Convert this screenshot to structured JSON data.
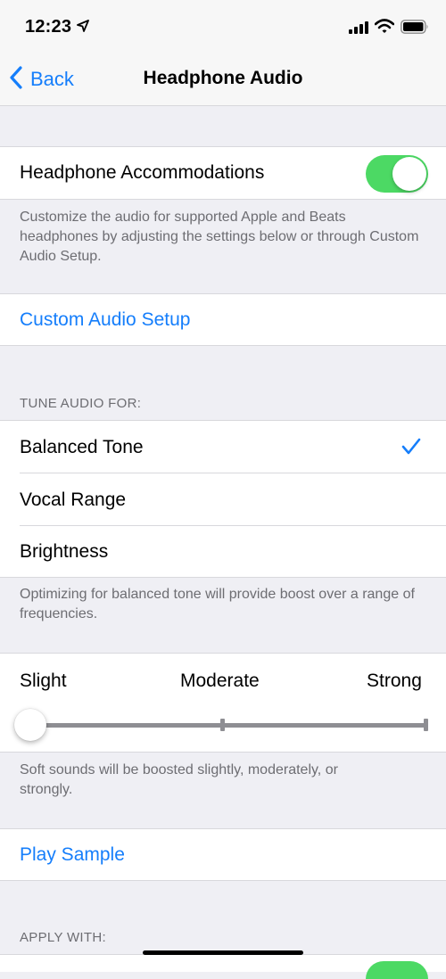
{
  "status_bar": {
    "time": "12:23",
    "icons": [
      "location-arrow-icon",
      "cellular-signal-icon",
      "wifi-icon",
      "battery-icon"
    ]
  },
  "nav": {
    "back_label": "Back",
    "title": "Headphone Audio"
  },
  "accommodations": {
    "label": "Headphone Accommodations",
    "enabled": true,
    "footer": "Customize the audio for supported Apple and Beats headphones by adjusting the settings below or through Custom Audio Setup."
  },
  "custom_setup": {
    "label": "Custom Audio Setup"
  },
  "tune": {
    "header": "TUNE AUDIO FOR:",
    "options": [
      {
        "label": "Balanced Tone",
        "selected": true
      },
      {
        "label": "Vocal Range",
        "selected": false
      },
      {
        "label": "Brightness",
        "selected": false
      }
    ],
    "footer": "Optimizing for balanced tone will provide boost over a range of frequencies."
  },
  "boost": {
    "labels": [
      "Slight",
      "Moderate",
      "Strong"
    ],
    "value": "Slight",
    "footer": "Soft sounds will be boosted slightly, moderately, or strongly."
  },
  "play_sample": {
    "label": "Play Sample"
  },
  "apply_with": {
    "header": "APPLY WITH:"
  },
  "colors": {
    "accent": "#157efb",
    "toggle_on": "#4cd964",
    "grouped_bg": "#efeff4",
    "secondary_text": "#6d6d72"
  }
}
